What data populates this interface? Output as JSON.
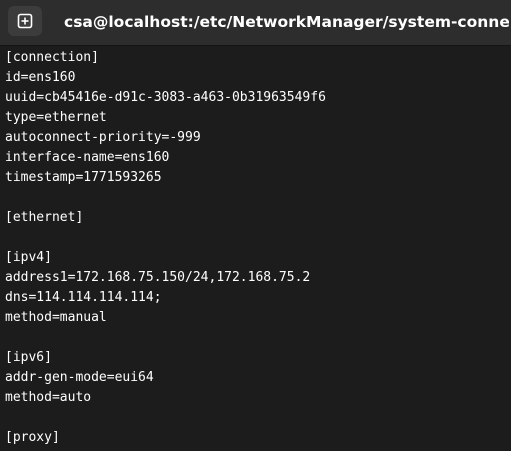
{
  "window": {
    "title": "csa@localhost:/etc/NetworkManager/system-connections — vi"
  },
  "icons": {
    "new_tab": "new-tab-icon"
  },
  "terminal": {
    "lines": [
      "[connection]",
      "id=ens160",
      "uuid=cb45416e-d91c-3083-a463-0b31963549f6",
      "type=ethernet",
      "autoconnect-priority=-999",
      "interface-name=ens160",
      "timestamp=1771593265",
      "",
      "[ethernet]",
      "",
      "[ipv4]",
      "address1=172.168.75.150/24,172.168.75.2",
      "dns=114.114.114.114;",
      "method=manual",
      "",
      "[ipv6]",
      "addr-gen-mode=eui64",
      "method=auto",
      "",
      "[proxy]"
    ]
  }
}
